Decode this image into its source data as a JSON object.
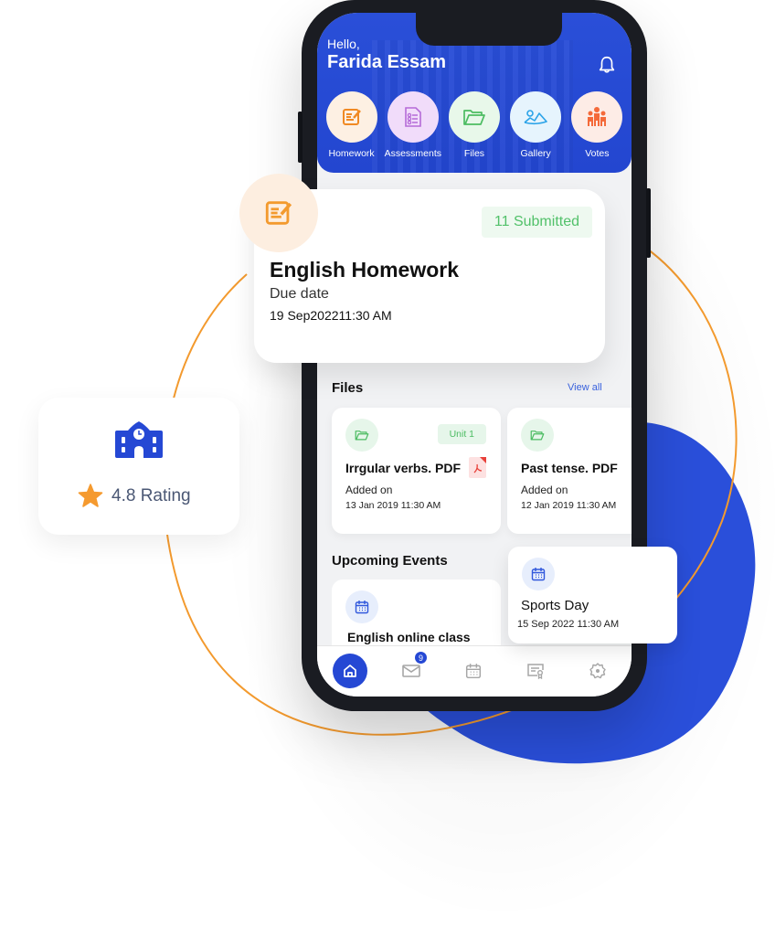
{
  "header": {
    "greeting": "Hello,",
    "user_name": "Farida Essam",
    "notification_icon": "bell-icon"
  },
  "quick_actions": [
    {
      "label": "Homework",
      "icon": "homework-icon",
      "bg": "#fdf0e3",
      "color": "#f08a24"
    },
    {
      "label": "Assessments",
      "icon": "assessment-icon",
      "bg": "#f1dcfa",
      "color": "#b56bd8"
    },
    {
      "label": "Files",
      "icon": "folder-icon",
      "bg": "#e8f8ea",
      "color": "#4cbc62"
    },
    {
      "label": "Gallery",
      "icon": "gallery-icon",
      "bg": "#e6f4fd",
      "color": "#2ba3e8"
    },
    {
      "label": "Votes",
      "icon": "votes-icon",
      "bg": "#fdece6",
      "color": "#f46a3a"
    }
  ],
  "homework_card": {
    "icon": "homework-icon",
    "submitted": "11 Submitted",
    "title": "English Homework",
    "due_label": "Due date",
    "due_date": "19 Sep2022",
    "due_time": "11:30 AM"
  },
  "files": {
    "title": "Files",
    "view_all": "View all",
    "items": [
      {
        "name": "Irrgular verbs. PDF",
        "tag": "Unit 1",
        "added_label": "Added on",
        "date": "13 Jan 2019  11:30 AM",
        "file_icon": "pdf-icon"
      },
      {
        "name": "Past tense. PDF",
        "tag": "",
        "added_label": "Added on",
        "date": "12 Jan 2019  11:30 AM"
      }
    ]
  },
  "events": {
    "title": "Upcoming Events",
    "items": [
      {
        "name": "English online class",
        "icon": "calendar-icon"
      },
      {
        "name": "Sports Day",
        "date": "15 Sep 2022 11:30 AM",
        "icon": "calendar-icon"
      }
    ]
  },
  "tabbar": {
    "items": [
      {
        "name": "home",
        "icon": "home-icon",
        "active": true
      },
      {
        "name": "messages",
        "icon": "mail-icon",
        "badge": "9"
      },
      {
        "name": "calendar",
        "icon": "calendar-icon"
      },
      {
        "name": "certificates",
        "icon": "certificate-icon"
      },
      {
        "name": "settings",
        "icon": "gear-icon"
      }
    ]
  },
  "rating_card": {
    "icon": "school-icon",
    "rating_text": "4.8 Rating",
    "star_icon": "star-icon"
  },
  "colors": {
    "brand_blue": "#2548d4",
    "accent_orange": "#f39a2e",
    "success_green": "#52c16a",
    "link_blue": "#3a63e0"
  }
}
